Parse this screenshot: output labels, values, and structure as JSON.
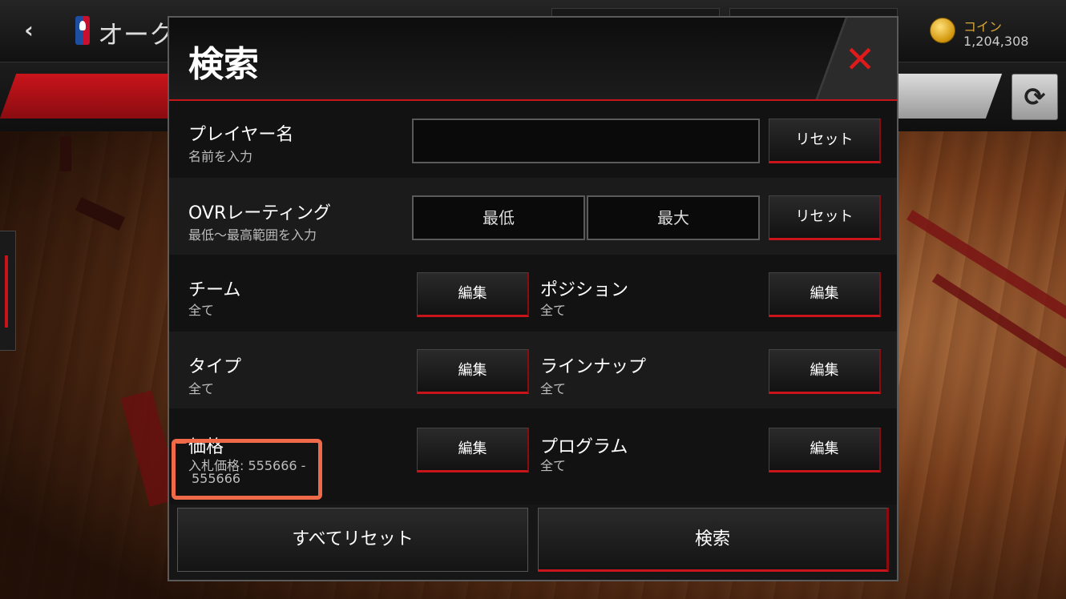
{
  "topbar": {
    "title": "オーク",
    "coin_label": "コイン",
    "coin_amount": "1,204,308"
  },
  "modal": {
    "title": "検索",
    "rows": {
      "player_name": {
        "label": "プレイヤー名",
        "sublabel": "名前を入力",
        "input_value": "",
        "reset_label": "リセット"
      },
      "ovr": {
        "label": "OVRレーティング",
        "sublabel": "最低〜最高範囲を入力",
        "min_placeholder": "最低",
        "max_placeholder": "最大",
        "reset_label": "リセット"
      },
      "team": {
        "label": "チーム",
        "sublabel": "全て",
        "edit_label": "編集"
      },
      "position": {
        "label": "ポジション",
        "sublabel": "全て",
        "edit_label": "編集"
      },
      "type": {
        "label": "タイプ",
        "sublabel": "全て",
        "edit_label": "編集"
      },
      "lineup": {
        "label": "ラインナップ",
        "sublabel": "全て",
        "edit_label": "編集"
      },
      "price": {
        "label": "価格",
        "sublabel_line1": "入札価格: 555666 -",
        "sublabel_line2": "555666",
        "edit_label": "編集"
      },
      "program": {
        "label": "プログラム",
        "sublabel": "全て",
        "edit_label": "編集"
      }
    },
    "reset_all_label": "すべてリセット",
    "search_label": "検索"
  },
  "colors": {
    "accent_red": "#c8141b",
    "highlight_annotation": "#f06a4a",
    "coin_gold": "#d8a63a"
  }
}
